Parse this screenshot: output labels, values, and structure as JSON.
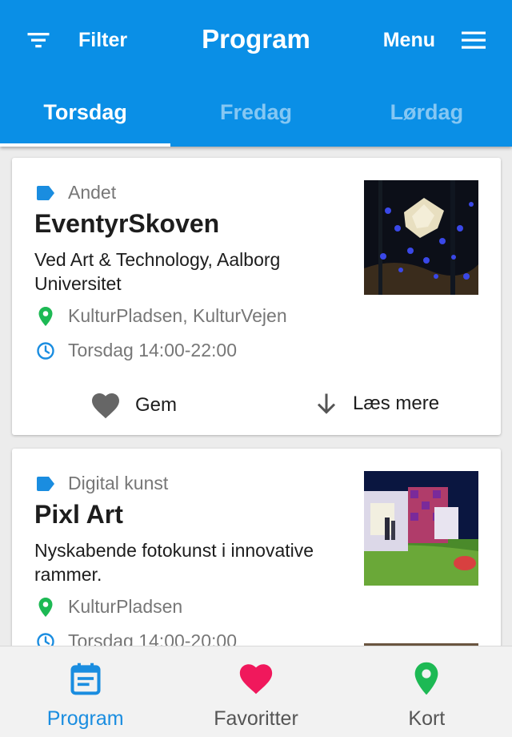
{
  "colors": {
    "primary": "#0a8fe6",
    "category": "#1a8de0",
    "location": "#1db954",
    "favorite": "#f0185c",
    "text": "#1d1d1d",
    "muted": "#777777"
  },
  "header": {
    "filter_label": "Filter",
    "title": "Program",
    "menu_label": "Menu",
    "tabs": [
      {
        "label": "Torsdag",
        "active": true
      },
      {
        "label": "Fredag",
        "active": false
      },
      {
        "label": "Lørdag",
        "active": false
      }
    ]
  },
  "events": [
    {
      "category": "Andet",
      "title": "EventyrSkoven",
      "description": "Ved Art & Technology, Aalborg Universitet",
      "location": "KulturPladsen, KulturVejen",
      "time": "Torsdag 14:00-22:00",
      "save_label": "Gem",
      "more_label": "Læs mere"
    },
    {
      "category": "Digital kunst",
      "title": "Pixl Art",
      "description": "Nyskabende fotokunst i innovative rammer.",
      "location": "KulturPladsen",
      "time": "Torsdag 14:00-20:00"
    }
  ],
  "bottom_nav": [
    {
      "label": "Program",
      "icon": "calendar-icon",
      "active": true
    },
    {
      "label": "Favoritter",
      "icon": "heart-icon",
      "active": false
    },
    {
      "label": "Kort",
      "icon": "map-pin-icon",
      "active": false
    }
  ]
}
